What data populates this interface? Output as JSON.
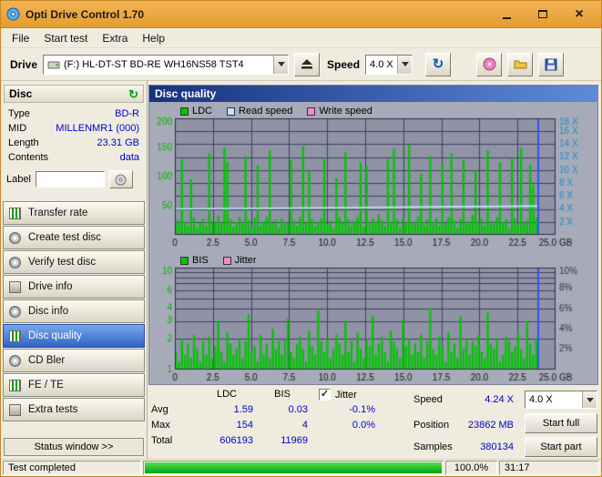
{
  "window": {
    "title": "Opti Drive Control 1.70",
    "controls": {
      "close": "×"
    }
  },
  "menu": {
    "items": [
      "File",
      "Start test",
      "Extra",
      "Help"
    ]
  },
  "toolbar": {
    "drive_label": "Drive",
    "drive_value": "(F:) HL-DT-ST BD-RE  WH16NS58 TST4",
    "speed_label": "Speed",
    "speed_value": "4.0 X",
    "refresh_glyph": "↻"
  },
  "sidebar": {
    "panel_title": "Disc",
    "refresh_glyph": "↻",
    "info": [
      {
        "label": "Type",
        "value": "BD-R"
      },
      {
        "label": "MID",
        "value": "MILLENMR1 (000)"
      },
      {
        "label": "Length",
        "value": "23.31 GB"
      },
      {
        "label": "Contents",
        "value": "data"
      }
    ],
    "label_label": "Label",
    "label_value": "",
    "buttons": [
      {
        "label": "Transfer rate",
        "selected": false
      },
      {
        "label": "Create test disc",
        "selected": false
      },
      {
        "label": "Verify test disc",
        "selected": false
      },
      {
        "label": "Drive info",
        "selected": false
      },
      {
        "label": "Disc info",
        "selected": false
      },
      {
        "label": "Disc quality",
        "selected": true
      },
      {
        "label": "CD Bler",
        "selected": false
      },
      {
        "label": "FE / TE",
        "selected": false
      },
      {
        "label": "Extra tests",
        "selected": false
      }
    ],
    "status_window": "Status window >>"
  },
  "main": {
    "header": "Disc quality",
    "legend1": [
      {
        "label": "LDC",
        "color": "#00C600"
      },
      {
        "label": "Read speed",
        "color": "#BCE8F8"
      },
      {
        "label": "Write speed",
        "color": "#F08CC8"
      }
    ],
    "legend2": [
      {
        "label": "BIS",
        "color": "#00C600"
      },
      {
        "label": "Jitter",
        "color": "#F08CC8"
      }
    ]
  },
  "stats": {
    "col_ldc": "LDC",
    "col_bis": "BIS",
    "col_jitter": "Jitter",
    "jitter_checked": true,
    "check_glyph": "✓",
    "rows": [
      {
        "label": "Avg",
        "ldc": "1.59",
        "bis": "0.03",
        "jitter": "-0.1%"
      },
      {
        "label": "Max",
        "ldc": "154",
        "bis": "4",
        "jitter": "0.0%"
      },
      {
        "label": "Total",
        "ldc": "606193",
        "bis": "11969",
        "jitter": ""
      }
    ],
    "speed_label": "Speed",
    "speed_value": "4.24 X",
    "position_label": "Position",
    "position_value": "23862 MB",
    "samples_label": "Samples",
    "samples_value": "380134",
    "speed_select": "4.0 X",
    "start_full": "Start full",
    "start_part": "Start part"
  },
  "statusbar": {
    "status": "Test completed",
    "progress_value": 100,
    "progress_pct": "100.0%",
    "time": "31:17"
  },
  "chart_data": [
    {
      "id": "chart-top",
      "type": "bar",
      "title": "LDC / read speed vs disc position",
      "x_axis": {
        "min": 0,
        "max": 25,
        "unit": "GB",
        "grid_step": 2.5,
        "ticks": [
          {
            "v": 0,
            "label": "0"
          },
          {
            "v": 2.5,
            "label": "2.5"
          },
          {
            "v": 5,
            "label": "5.0"
          },
          {
            "v": 7.5,
            "label": "7.5"
          },
          {
            "v": 10,
            "label": "10.0"
          },
          {
            "v": 12.5,
            "label": "12.5"
          },
          {
            "v": 15,
            "label": "15.0"
          },
          {
            "v": 17.5,
            "label": "17.5"
          },
          {
            "v": 20,
            "label": "20.0"
          },
          {
            "v": 22.5,
            "label": "22.5"
          },
          {
            "v": 25,
            "label": "25.0 GB"
          }
        ]
      },
      "left_axis": {
        "color": "#00B400",
        "scale": "linear",
        "min": 0,
        "max": 200,
        "ticks": [
          {
            "v": 200,
            "label": "200"
          },
          {
            "v": 150,
            "label": "150"
          },
          {
            "v": 100,
            "label": "100"
          },
          {
            "v": 50,
            "label": "50"
          }
        ]
      },
      "right_axis": {
        "color": "#2090C8",
        "min": 0,
        "max": 18,
        "grid": {
          "mode": "linear",
          "step": 2
        },
        "ticks": [
          {
            "v": 18,
            "label": "18 X"
          },
          {
            "v": 16,
            "label": "16 X"
          },
          {
            "v": 14,
            "label": "14 X"
          },
          {
            "v": 12,
            "label": "12 X"
          },
          {
            "v": 10,
            "label": "10 X"
          },
          {
            "v": 8,
            "label": "8 X"
          },
          {
            "v": 6,
            "label": "6 X"
          },
          {
            "v": 4,
            "label": "4 X"
          },
          {
            "v": 2,
            "label": "2 X"
          }
        ]
      },
      "data_end_x": 23.86,
      "marker": {
        "x": 23.86,
        "color": "#3352F0"
      },
      "series": [
        {
          "name": "LDC",
          "kind": "bar",
          "color": "#00C600",
          "values": [
            18,
            25,
            130,
            22,
            15,
            95,
            30,
            12,
            20,
            28,
            16,
            140,
            24,
            19,
            33,
            21,
            150,
            125,
            27,
            14,
            22,
            30,
            18,
            135,
            25,
            11,
            29,
            120,
            17,
            23,
            31,
            145,
            20,
            26,
            13,
            28,
            22,
            19,
            128,
            24,
            16,
            30,
            152,
            21,
            110,
            27,
            15,
            23,
            29,
            132,
            18,
            25,
            12,
            98,
            31,
            20,
            142,
            26,
            17,
            24,
            30,
            125,
            14,
            118,
            22,
            28,
            19,
            35,
            25,
            16,
            130,
            23,
            148,
            27,
            13,
            29,
            21,
            155,
            18,
            24,
            31,
            105,
            17,
            26,
            135,
            22,
            28,
            15,
            122,
            20,
            30,
            140,
            25,
            12,
            27,
            128,
            19,
            23,
            34,
            112,
            21,
            29,
            16,
            145,
            24,
            18,
            30,
            125,
            22,
            26,
            13,
            132,
            28,
            17,
            150,
            21,
            25,
            120,
            85,
            30
          ]
        },
        {
          "name": "Read speed",
          "kind": "line",
          "color": "#BCE8F8",
          "points": [
            [
              0,
              4.0
            ],
            [
              4,
              4.08
            ],
            [
              8,
              4.15
            ],
            [
              12,
              4.22
            ],
            [
              16,
              4.3
            ],
            [
              20,
              4.38
            ],
            [
              23.86,
              4.45
            ]
          ]
        },
        {
          "name": "Write speed",
          "kind": "line",
          "color": "#F08CC8",
          "points": []
        }
      ]
    },
    {
      "id": "chart-bot",
      "type": "bar",
      "title": "BIS / jitter vs disc position",
      "x_axis": {
        "min": 0,
        "max": 25,
        "unit": "GB",
        "grid_step": 2.5,
        "ticks": [
          {
            "v": 0,
            "label": "0"
          },
          {
            "v": 2.5,
            "label": "2.5"
          },
          {
            "v": 5,
            "label": "5.0"
          },
          {
            "v": 7.5,
            "label": "7.5"
          },
          {
            "v": 10,
            "label": "10.0"
          },
          {
            "v": 12.5,
            "label": "12.5"
          },
          {
            "v": 15,
            "label": "15.0"
          },
          {
            "v": 17.5,
            "label": "17.5"
          },
          {
            "v": 20,
            "label": "20.0"
          },
          {
            "v": 22.5,
            "label": "22.5"
          },
          {
            "v": 25,
            "label": "25.0 GB"
          }
        ]
      },
      "left_axis": {
        "color": "#00B400",
        "scale": "log",
        "min": 1,
        "max": 10,
        "ticks": [
          {
            "v": 10,
            "label": "10"
          },
          {
            "v": 6,
            "label": "6"
          },
          {
            "v": 4,
            "label": "4"
          },
          {
            "v": 3,
            "label": "3"
          },
          {
            "v": 2,
            "label": "2"
          },
          {
            "v": 1,
            "label": "1"
          }
        ]
      },
      "right_axis": {
        "color": "#333344",
        "min": 0,
        "max": 10,
        "grid": {
          "mode": "log"
        },
        "ticks": [
          {
            "v": 10,
            "label": "10%"
          },
          {
            "v": 8,
            "label": "8%"
          },
          {
            "v": 6,
            "label": "6%"
          },
          {
            "v": 4,
            "label": "4%"
          },
          {
            "v": 2,
            "label": "2%"
          }
        ]
      },
      "data_end_x": 23.86,
      "marker": {
        "x": 23.86,
        "color": "#3352F0"
      },
      "series": [
        {
          "name": "BIS",
          "kind": "bar",
          "color": "#00C600",
          "values": [
            1.5,
            1.2,
            2.0,
            1.4,
            1.8,
            1.3,
            2.2,
            1.6,
            1.2,
            1.9,
            1.4,
            2.1,
            1.3,
            1.7,
            3.0,
            1.5,
            1.2,
            2.3,
            1.8,
            1.4,
            1.6,
            2.0,
            1.3,
            1.9,
            3.5,
            1.5,
            1.7,
            1.2,
            2.2,
            1.4,
            1.8,
            1.3,
            2.5,
            1.6,
            1.9,
            1.4,
            2.0,
            3.2,
            1.5,
            1.3,
            1.8,
            2.1,
            1.6,
            1.2,
            2.4,
            1.7,
            1.4,
            3.8,
            1.9,
            1.5,
            2.0,
            1.3,
            1.6,
            2.2,
            1.8,
            1.4,
            3.0,
            1.5,
            1.9,
            1.2,
            2.3,
            1.6,
            1.3,
            2.0,
            1.7,
            3.4,
            1.4,
            1.8,
            2.1,
            1.5,
            1.2,
            2.4,
            1.9,
            1.6,
            1.3,
            3.1,
            1.7,
            2.0,
            1.4,
            1.8,
            1.5,
            2.2,
            1.3,
            1.9,
            4.0,
            1.6,
            1.4,
            2.1,
            1.7,
            1.2,
            2.3,
            1.5,
            1.8,
            1.3,
            3.3,
            1.6,
            2.0,
            1.4,
            1.9,
            1.7,
            2.2,
            1.5,
            1.3,
            3.6,
            1.8,
            1.6,
            2.0,
            1.2,
            1.4,
            2.1,
            1.9,
            1.5,
            1.7,
            2.3,
            1.6,
            1.3,
            3.0,
            1.8,
            1.4,
            2.0
          ]
        },
        {
          "name": "Jitter",
          "kind": "line",
          "color": "#F08CC8",
          "points": []
        }
      ]
    }
  ]
}
